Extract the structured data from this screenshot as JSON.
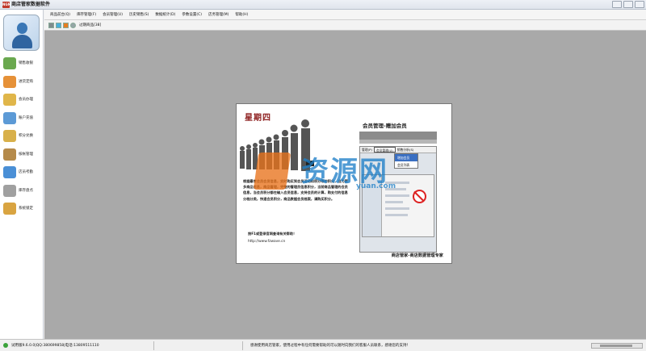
{
  "window": {
    "title": "商店管家数据软件",
    "app_icon_text": "NGM"
  },
  "sidebar": {
    "items": [
      {
        "label": "销售收银",
        "icon": "cash-register-icon",
        "color": "#6aa84f"
      },
      {
        "label": "进货定购",
        "icon": "box-icon",
        "color": "#e69138"
      },
      {
        "label": "会员办理",
        "icon": "member-card-icon",
        "color": "#e0b64a"
      },
      {
        "label": "账户充值",
        "icon": "money-icon",
        "color": "#5c9ad6"
      },
      {
        "label": "积分兑换",
        "icon": "gift-icon",
        "color": "#d8b04a"
      },
      {
        "label": "核帐管理",
        "icon": "pen-icon",
        "color": "#b58a4a"
      },
      {
        "label": "店员考勤",
        "icon": "staff-icon",
        "color": "#4a8fd6"
      },
      {
        "label": "库存盘点",
        "icon": "inventory-icon",
        "color": "#a0a0a0"
      },
      {
        "label": "系统锁定",
        "icon": "lock-icon",
        "color": "#d9a441"
      }
    ]
  },
  "menu": {
    "items": [
      "商品前台(Q)",
      "库存管理(F)",
      "会员管理(U)",
      "历史销售(S)",
      "数据统计(D)",
      "参数设置(C)",
      "店务管理(M)",
      "帮助(H)"
    ]
  },
  "toolbar": {
    "icons": [
      "grid-icon",
      "layout-icon",
      "tile-icon",
      "speaker-icon"
    ],
    "expired_label": "过期商品[38]"
  },
  "splash": {
    "weekday": "星期四",
    "module_title": "会员管理-赠加会员",
    "description": "根据最常会员会员信息，实时购买到会员活动和积分等的积分，当为更多商品信息，商品管理，完整的管理员信息积分，当前商品管理的会员信息，当会员积分都在输入会员信息，支持会员的计算，购支付的信息分档分类，快速会员积分，商品数据会员档案，请购买积分。",
    "hint": "按F1或登录官网查询有关帮助！",
    "url": "http://www.fzwave.cn",
    "slogan": "商店管家-商店数据管理专家",
    "inner_menu": [
      "管理(P)",
      "会员管理(U)",
      "销售分析(S)"
    ],
    "dropdown": [
      "增加会员",
      "会员列表"
    ],
    "watermark_text": "资源网",
    "watermark_url": "yuan.com"
  },
  "status": {
    "version": "试用版9.6.0.0|QQ:380699858|电话:13809511110",
    "message": "感谢使用商店管家，使用过程中有任何需要帮助的可以随时向我们的客服人员联系，感谢您的支持！"
  }
}
